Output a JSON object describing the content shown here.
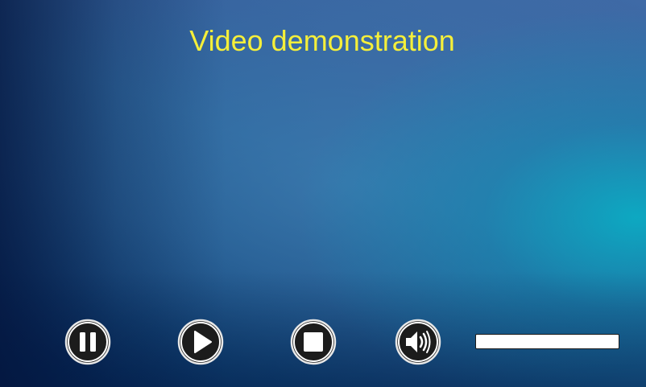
{
  "title": "Video demonstration",
  "controls": {
    "pause_icon": "pause-icon",
    "play_icon": "play-icon",
    "stop_icon": "stop-icon",
    "volume_icon": "volume-icon"
  },
  "progress": {
    "value": 0
  },
  "colors": {
    "title": "#f5ef3a",
    "button_fill": "#1c1c1c",
    "button_ring": "#ffffff",
    "progress_track": "#ffffff"
  }
}
